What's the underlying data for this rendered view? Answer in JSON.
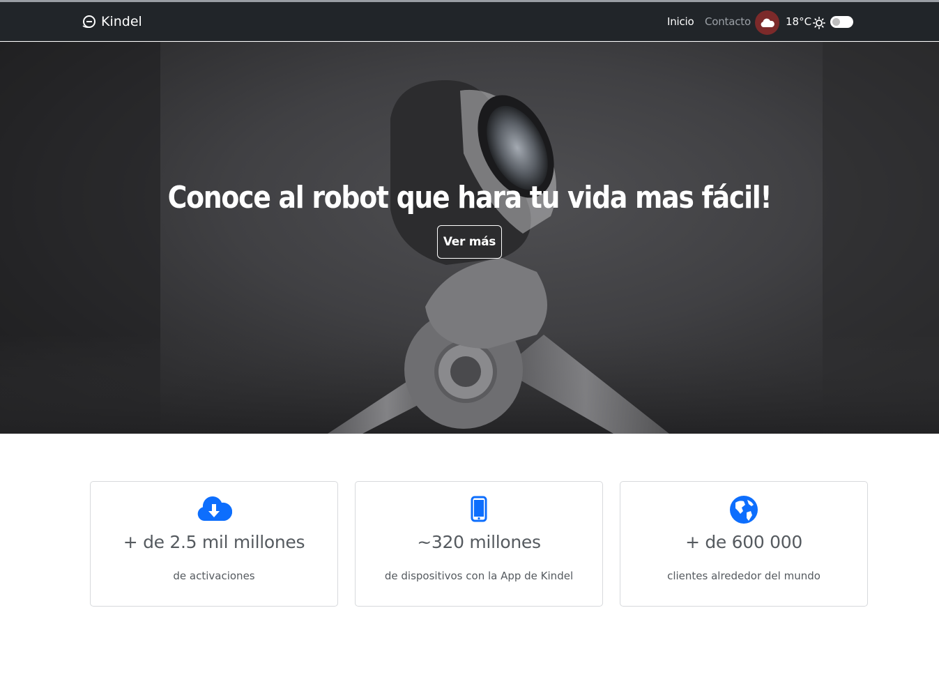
{
  "navbar": {
    "brand": "Kindel",
    "links": [
      {
        "label": "Inicio",
        "active": true
      },
      {
        "label": "Contacto",
        "active": false
      }
    ],
    "weather": {
      "icon": "cloud-icon",
      "temperature": "18°C"
    },
    "theme_toggle": {
      "icon": "sun-icon",
      "enabled": false
    }
  },
  "hero": {
    "title": "Conoce al robot que hara tu vida mas fácil!",
    "button": "Ver más"
  },
  "stats": [
    {
      "icon": "cloud-download-icon",
      "value": "+ de 2.5 mil millones",
      "label": "de activaciones"
    },
    {
      "icon": "mobile-phone-icon",
      "value": "~320 millones",
      "label": "de dispositivos con la App de Kindel"
    },
    {
      "icon": "globe-icon",
      "value": "+ de 600 000",
      "label": "clientes alrededor del mundo"
    }
  ],
  "colors": {
    "navbar_bg": "#212529",
    "accent_blue": "#0d6efd",
    "weather_badge": "#7c2a2a",
    "text_muted": "#555a5f"
  }
}
